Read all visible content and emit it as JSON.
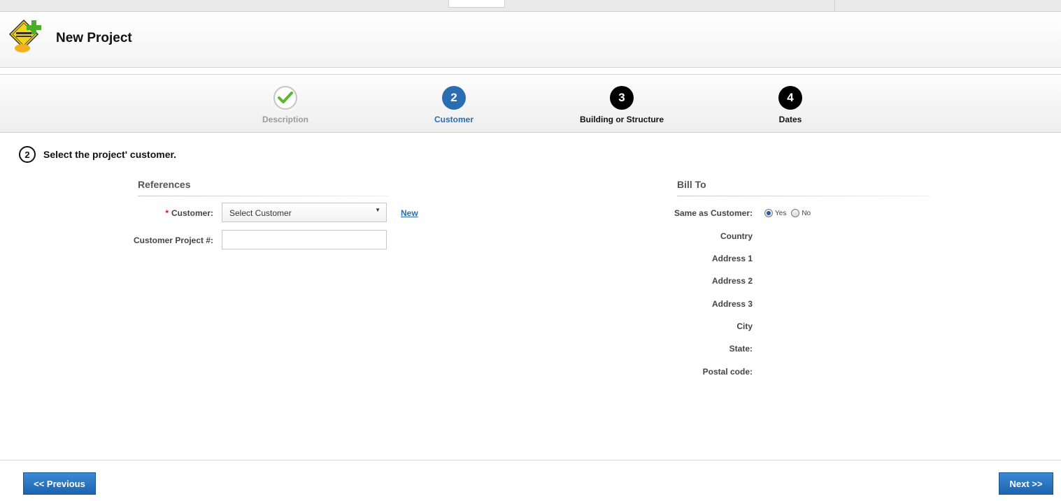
{
  "header": {
    "title": "New Project",
    "logo_icon": "under-construction-icon"
  },
  "wizard": {
    "steps": [
      {
        "label": "Description",
        "number": "",
        "state": "done"
      },
      {
        "label": "Customer",
        "number": "2",
        "state": "active"
      },
      {
        "label": "Building or Structure",
        "number": "3",
        "state": "todo"
      },
      {
        "label": "Dates",
        "number": "4",
        "state": "todo"
      }
    ],
    "active_color": "#2a6db0"
  },
  "section": {
    "number": "2",
    "heading": "Select the project' customer."
  },
  "references": {
    "title": "References",
    "customer_label": "Customer:",
    "customer_required_mark": "*",
    "customer_select_value": "Select Customer",
    "new_link": "New",
    "project_number_label": "Customer Project #:",
    "project_number_value": ""
  },
  "bill_to": {
    "title": "Bill To",
    "same_as_customer_label": "Same as Customer:",
    "options": [
      "Yes",
      "No"
    ],
    "selected": "Yes",
    "country_label": "Country",
    "address1_label": "Address 1",
    "address2_label": "Address 2",
    "address3_label": "Address 3",
    "city_label": "City",
    "state_label": "State:",
    "postal_label": "Postal code:"
  },
  "footer": {
    "previous_label": "<< Previous",
    "next_label": "Next >>"
  }
}
